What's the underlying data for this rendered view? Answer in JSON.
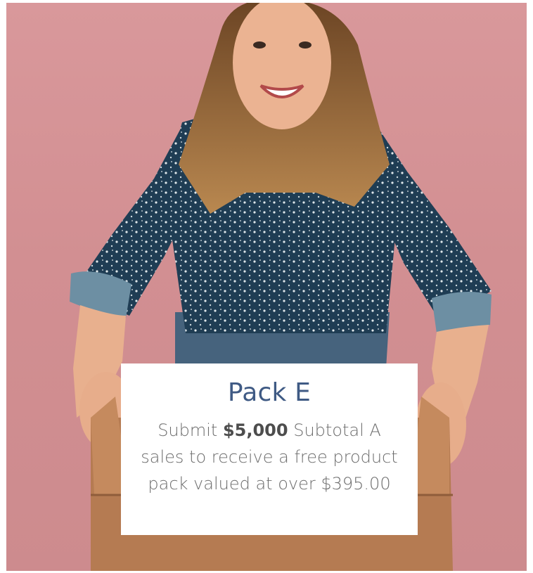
{
  "card": {
    "title": "Pack E",
    "body_prefix": "Submit ",
    "body_amount": "$5,000",
    "body_suffix": " Subtotal A sales to receive a free product pack valued at over $395.00"
  },
  "colors": {
    "background": "#d4929a",
    "title": "#3f5a84",
    "body_text": "#6d6d6d",
    "card_background": "#ffffff"
  }
}
